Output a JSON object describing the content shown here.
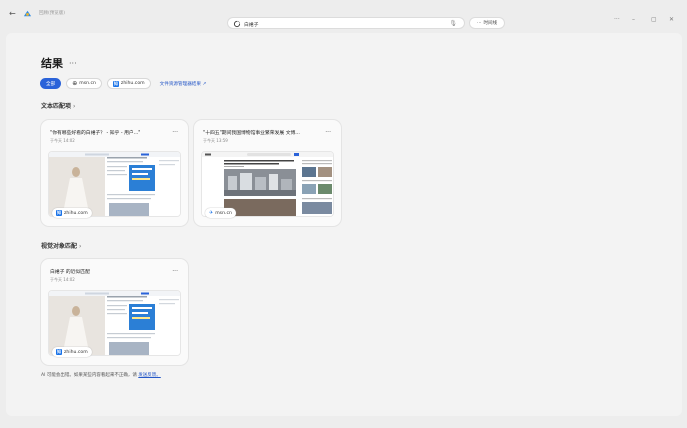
{
  "titlebar": {
    "app_name": "回顾(预览版)",
    "search_query": "白裙子",
    "timeline_label": "时间线"
  },
  "results": {
    "title": "结果",
    "more": "···",
    "filters": [
      {
        "label": "全部",
        "active": true
      },
      {
        "label": "msn.cn",
        "active": false
      },
      {
        "label": "zhihu.com",
        "active": false
      }
    ],
    "file_explorer_link": "文件资源管理器结果 ↗"
  },
  "text_matches": {
    "heading": "文本匹配项",
    "chevron": "›",
    "cards": [
      {
        "title": "\"你有哪些好看的白裙子？ - 知乎 - 用户...\"",
        "time": "于今天 14:02",
        "more": "···",
        "source": "zhihu.com"
      },
      {
        "title": "\"十四五\"期间我国博物馆事业繁荣发展 文博...",
        "time": "于今天 13:59",
        "more": "···",
        "source": "msn.cn"
      }
    ]
  },
  "visual_matches": {
    "heading": "视觉对象匹配",
    "chevron": "›",
    "cards": [
      {
        "title": "白裙子 的近似匹配",
        "time": "于今天 14:02",
        "more": "···",
        "source": "zhihu.com"
      }
    ]
  },
  "disclaimer": {
    "text": "AI 可能会出错。如果某些内容看起来不正确，请",
    "link": "发送反馈。"
  },
  "colors": {
    "accent": "#2b63d9",
    "link": "#2557c7"
  }
}
